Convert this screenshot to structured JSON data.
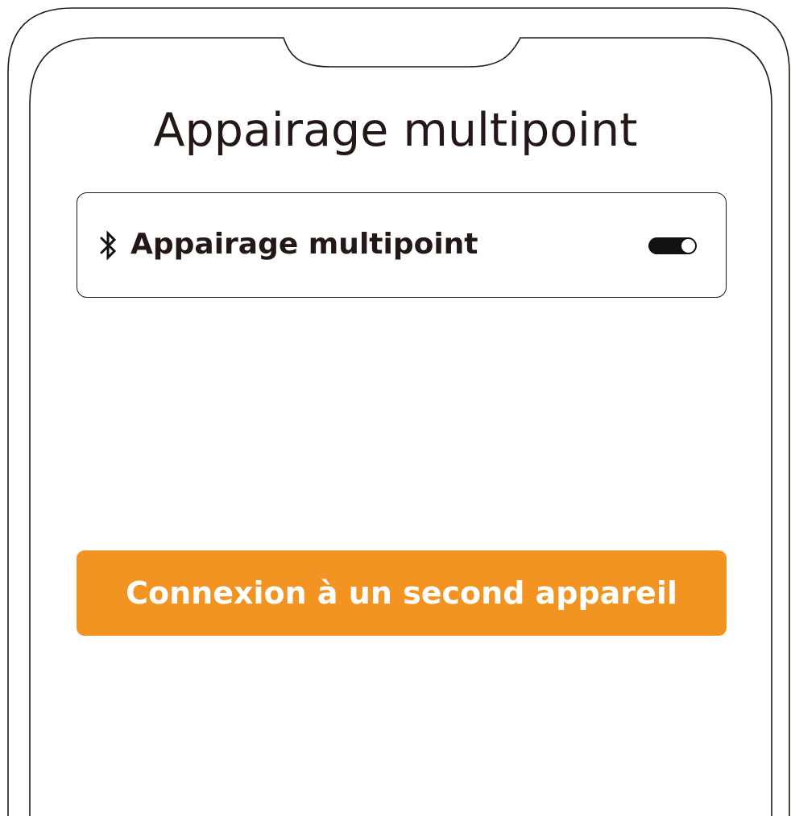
{
  "screen": {
    "title": "Appairage multipoint"
  },
  "setting": {
    "icon": "bluetooth-icon",
    "label": "Appairage multipoint",
    "toggle_state": "on"
  },
  "primary_action": {
    "label": "Connexion à un second appareil"
  },
  "colors": {
    "accent": "#F39322",
    "text": "#231815",
    "outline": "#231815",
    "toggle_on": "#111111"
  }
}
